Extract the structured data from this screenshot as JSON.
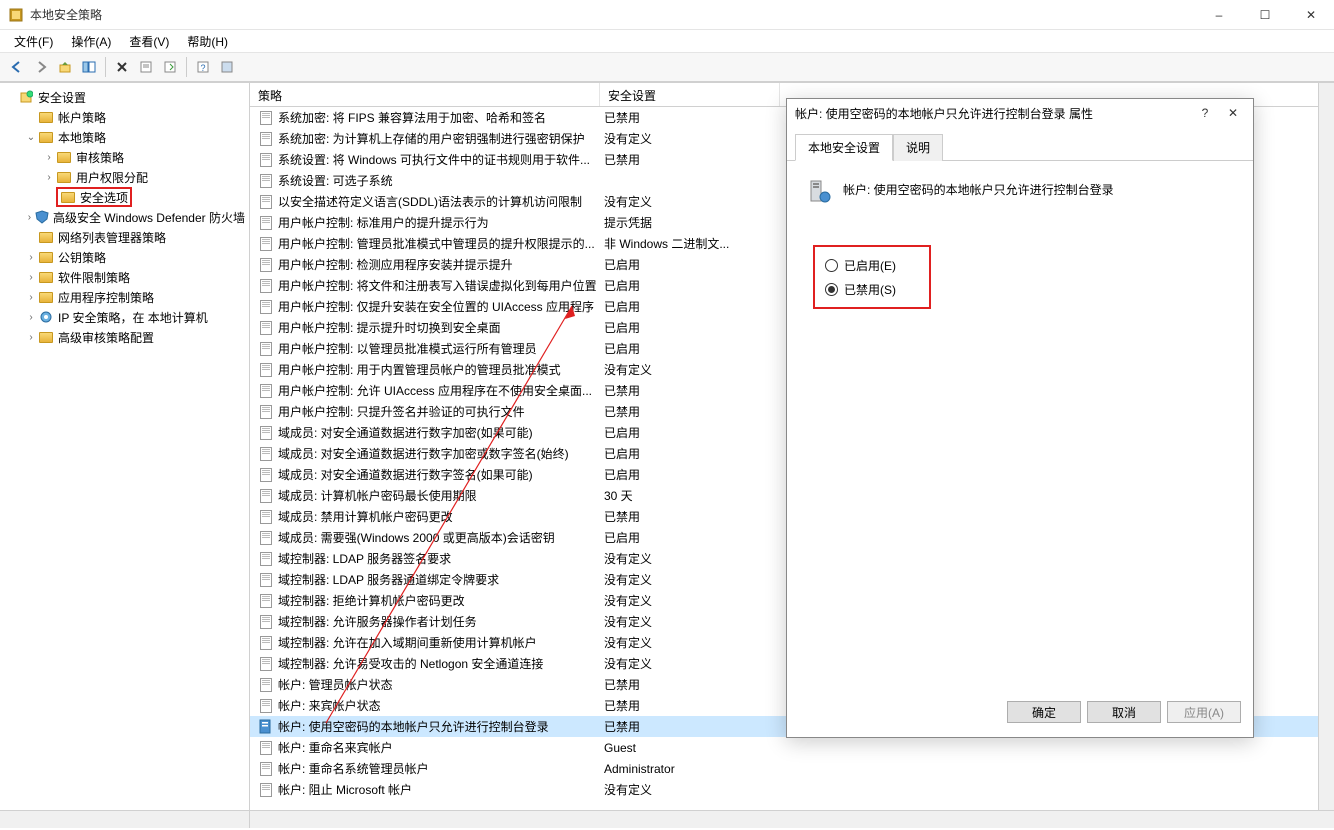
{
  "window": {
    "title": "本地安全策略",
    "minimize": "–",
    "maximize": "☐",
    "close": "✕"
  },
  "menubar": [
    "文件(F)",
    "操作(A)",
    "查看(V)",
    "帮助(H)"
  ],
  "tree": {
    "root": "安全设置",
    "items": [
      {
        "depth": 1,
        "exp": "",
        "label": "帐户策略",
        "icon": "folder"
      },
      {
        "depth": 1,
        "exp": "v",
        "label": "本地策略",
        "icon": "folder"
      },
      {
        "depth": 2,
        "exp": ">",
        "label": "审核策略",
        "icon": "folder"
      },
      {
        "depth": 2,
        "exp": ">",
        "label": "用户权限分配",
        "icon": "folder"
      },
      {
        "depth": 2,
        "exp": "",
        "label": "安全选项",
        "icon": "folder",
        "highlight": true
      },
      {
        "depth": 1,
        "exp": ">",
        "label": "高级安全 Windows Defender 防火墙",
        "icon": "shield"
      },
      {
        "depth": 1,
        "exp": "",
        "label": "网络列表管理器策略",
        "icon": "folder"
      },
      {
        "depth": 1,
        "exp": ">",
        "label": "公钥策略",
        "icon": "folder"
      },
      {
        "depth": 1,
        "exp": ">",
        "label": "软件限制策略",
        "icon": "folder"
      },
      {
        "depth": 1,
        "exp": ">",
        "label": "应用程序控制策略",
        "icon": "folder"
      },
      {
        "depth": 1,
        "exp": ">",
        "label": "IP 安全策略，在 本地计算机",
        "icon": "ip"
      },
      {
        "depth": 1,
        "exp": ">",
        "label": "高级审核策略配置",
        "icon": "folder"
      }
    ]
  },
  "list": {
    "header_policy": "策略",
    "header_setting": "安全设置",
    "rows": [
      {
        "policy": "系统加密: 将 FIPS 兼容算法用于加密、哈希和签名",
        "setting": "已禁用"
      },
      {
        "policy": "系统加密: 为计算机上存储的用户密钥强制进行强密钥保护",
        "setting": "没有定义"
      },
      {
        "policy": "系统设置: 将 Windows 可执行文件中的证书规则用于软件...",
        "setting": "已禁用"
      },
      {
        "policy": "系统设置: 可选子系统",
        "setting": ""
      },
      {
        "policy": "以安全描述符定义语言(SDDL)语法表示的计算机访问限制",
        "setting": "没有定义"
      },
      {
        "policy": "用户帐户控制: 标准用户的提升提示行为",
        "setting": "提示凭据"
      },
      {
        "policy": "用户帐户控制: 管理员批准模式中管理员的提升权限提示的...",
        "setting": "非 Windows 二进制文..."
      },
      {
        "policy": "用户帐户控制: 检测应用程序安装并提示提升",
        "setting": "已启用"
      },
      {
        "policy": "用户帐户控制: 将文件和注册表写入错误虚拟化到每用户位置",
        "setting": "已启用"
      },
      {
        "policy": "用户帐户控制: 仅提升安装在安全位置的 UIAccess 应用程序",
        "setting": "已启用"
      },
      {
        "policy": "用户帐户控制: 提示提升时切换到安全桌面",
        "setting": "已启用"
      },
      {
        "policy": "用户帐户控制: 以管理员批准模式运行所有管理员",
        "setting": "已启用"
      },
      {
        "policy": "用户帐户控制: 用于内置管理员帐户的管理员批准模式",
        "setting": "没有定义"
      },
      {
        "policy": "用户帐户控制: 允许 UIAccess 应用程序在不使用安全桌面...",
        "setting": "已禁用"
      },
      {
        "policy": "用户帐户控制: 只提升签名并验证的可执行文件",
        "setting": "已禁用"
      },
      {
        "policy": "域成员: 对安全通道数据进行数字加密(如果可能)",
        "setting": "已启用"
      },
      {
        "policy": "域成员: 对安全通道数据进行数字加密或数字签名(始终)",
        "setting": "已启用"
      },
      {
        "policy": "域成员: 对安全通道数据进行数字签名(如果可能)",
        "setting": "已启用"
      },
      {
        "policy": "域成员: 计算机帐户密码最长使用期限",
        "setting": "30 天"
      },
      {
        "policy": "域成员: 禁用计算机帐户密码更改",
        "setting": "已禁用"
      },
      {
        "policy": "域成员: 需要强(Windows 2000 或更高版本)会话密钥",
        "setting": "已启用"
      },
      {
        "policy": "域控制器: LDAP 服务器签名要求",
        "setting": "没有定义"
      },
      {
        "policy": "域控制器: LDAP 服务器通道绑定令牌要求",
        "setting": "没有定义"
      },
      {
        "policy": "域控制器: 拒绝计算机帐户密码更改",
        "setting": "没有定义"
      },
      {
        "policy": "域控制器: 允许服务器操作者计划任务",
        "setting": "没有定义"
      },
      {
        "policy": "域控制器:   允许在加入域期间重新使用计算机帐户",
        "setting": "没有定义"
      },
      {
        "policy": "域控制器: 允许易受攻击的 Netlogon 安全通道连接",
        "setting": "没有定义"
      },
      {
        "policy": "帐户: 管理员帐户状态",
        "setting": "已禁用"
      },
      {
        "policy": "帐户: 来宾帐户状态",
        "setting": "已禁用"
      },
      {
        "policy": "帐户: 使用空密码的本地帐户只允许进行控制台登录",
        "setting": "已禁用",
        "selected": true
      },
      {
        "policy": "帐户: 重命名来宾帐户",
        "setting": "Guest"
      },
      {
        "policy": "帐户: 重命名系统管理员帐户",
        "setting": "Administrator"
      },
      {
        "policy": "帐户: 阻止 Microsoft 帐户",
        "setting": "没有定义"
      }
    ]
  },
  "dialog": {
    "title": "帐户: 使用空密码的本地帐户只允许进行控制台登录 属性",
    "help": "?",
    "close": "✕",
    "tab_local": "本地安全设置",
    "tab_explain": "说明",
    "policy_name": "帐户: 使用空密码的本地帐户只允许进行控制台登录",
    "radio_enabled": "已启用(E)",
    "radio_disabled": "已禁用(S)",
    "btn_ok": "确定",
    "btn_cancel": "取消",
    "btn_apply": "应用(A)"
  }
}
